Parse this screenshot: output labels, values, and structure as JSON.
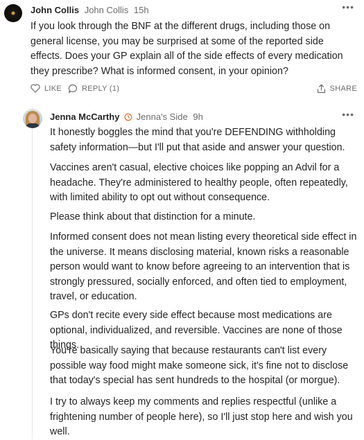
{
  "comment1": {
    "author": "John Collis",
    "handle": "John Collis",
    "time": "15h",
    "more_label": "•••",
    "text": "If you look through the BNF at the different drugs, including those on general license, you may be surprised at some of the reported side effects. Does your GP explain all of the side effects of every medication they prescribe? What is informed consent, in your opinion?",
    "actions": {
      "like_icon": "heart-outline-icon",
      "like_label": "LIKE",
      "reply_icon": "speech-bubble-icon",
      "reply_label": "REPLY (1)",
      "share_icon": "share-upload-icon",
      "share_label": "SHARE"
    }
  },
  "reply1": {
    "author": "Jenna McCarthy",
    "badge_icon": "clock-badge-icon",
    "badge_color": "#e27a3f",
    "handle": "Jenna's Side",
    "time": "9h",
    "more_label": "•••",
    "paragraphs": [
      "It honestly boggles the mind that you're DEFENDING withholding safety information—but I'll put that aside and answer your question.",
      "Vaccines aren't casual, elective choices like popping an Advil for a headache. They're administered to healthy people, often repeatedly, with limited ability to opt out without consequence.",
      "Please think about that distinction for a minute.",
      "Informed consent does not mean listing every theoretical side effect in the universe. It means disclosing material, known risks a reasonable person would want to know before agreeing to an intervention that is strongly pressured, socially enforced, and often tied to employment, travel, or education.",
      "GPs don't recite every side effect because most medications are optional, individualized, and reversible. Vaccines are none of those things.",
      "You're basically saying that because restaurants can't list every possible way food might make someone sick, it's fine not to disclose that today's special has sent hundreds to the hospital (or morgue).",
      "I try to always keep my comments and replies respectful (unlike a frightening number of people here), so I'll just stop here and wish you well."
    ]
  }
}
